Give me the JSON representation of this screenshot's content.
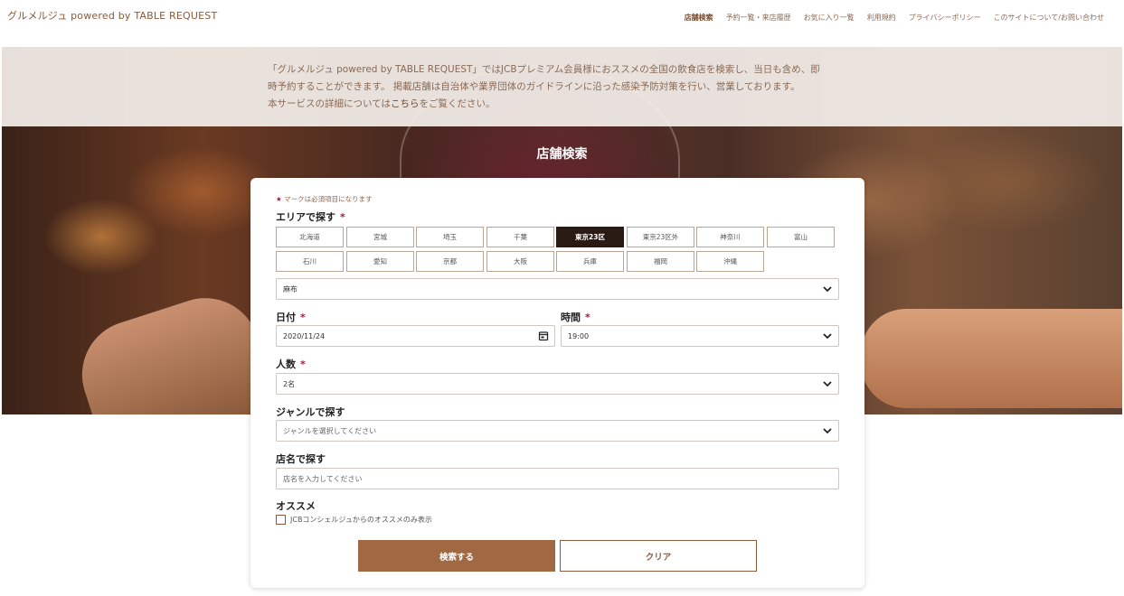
{
  "header": {
    "brand": "グルメルジュ powered by TABLE REQUEST",
    "nav": [
      {
        "label": "店舗検索",
        "active": true
      },
      {
        "label": "予約一覧・来店履歴"
      },
      {
        "label": "お気に入り一覧"
      },
      {
        "label": "利用規約"
      },
      {
        "label": "プライバシーポリシー"
      },
      {
        "label": "このサイトについて/お問い合わせ"
      }
    ]
  },
  "hero": {
    "intro_line1": "「グルメルジュ powered by TABLE REQUEST」ではJCBプレミアム会員様におススメの全国の飲食店を検索し、当日も含め、即",
    "intro_line2": "時予約することができます。 掲載店舗は自治体や業界団体のガイドラインに沿った感染予防対策を行い、営業しております。",
    "intro_line3_pre": "本サービスの詳細については",
    "intro_link": "こちら",
    "intro_line3_post": "をご覧ください。",
    "title": "店舗検索"
  },
  "form": {
    "required_note": "マークは必須項目になります",
    "required_star": "★",
    "label_star": "*",
    "area_label": "エリアで探す",
    "areas": [
      "北海道",
      "宮城",
      "埼玉",
      "千葉",
      "東京23区",
      "東京23区外",
      "神奈川",
      "富山",
      "石川",
      "愛知",
      "京都",
      "大阪",
      "兵庫",
      "福岡",
      "沖縄"
    ],
    "selected_area": "東京23区",
    "sub_area_value": "麻布",
    "date_label": "日付",
    "date_value": "2020/11/24",
    "time_label": "時間",
    "time_value": "19:00",
    "people_label": "人数",
    "people_value": "2名",
    "genre_label": "ジャンルで探す",
    "genre_placeholder": "ジャンルを選択してください",
    "store_label": "店名で探す",
    "store_placeholder": "店名を入力してください",
    "recommend_label": "オススメ",
    "recommend_checkbox": "JCBコンシェルジュからのオススメのみ表示",
    "recommend_checked": false,
    "search_button": "検索する",
    "clear_button": "クリア"
  },
  "colors": {
    "accent": "#a06843",
    "selected_area_bg": "#2a1a14",
    "required": "#a0203a"
  }
}
